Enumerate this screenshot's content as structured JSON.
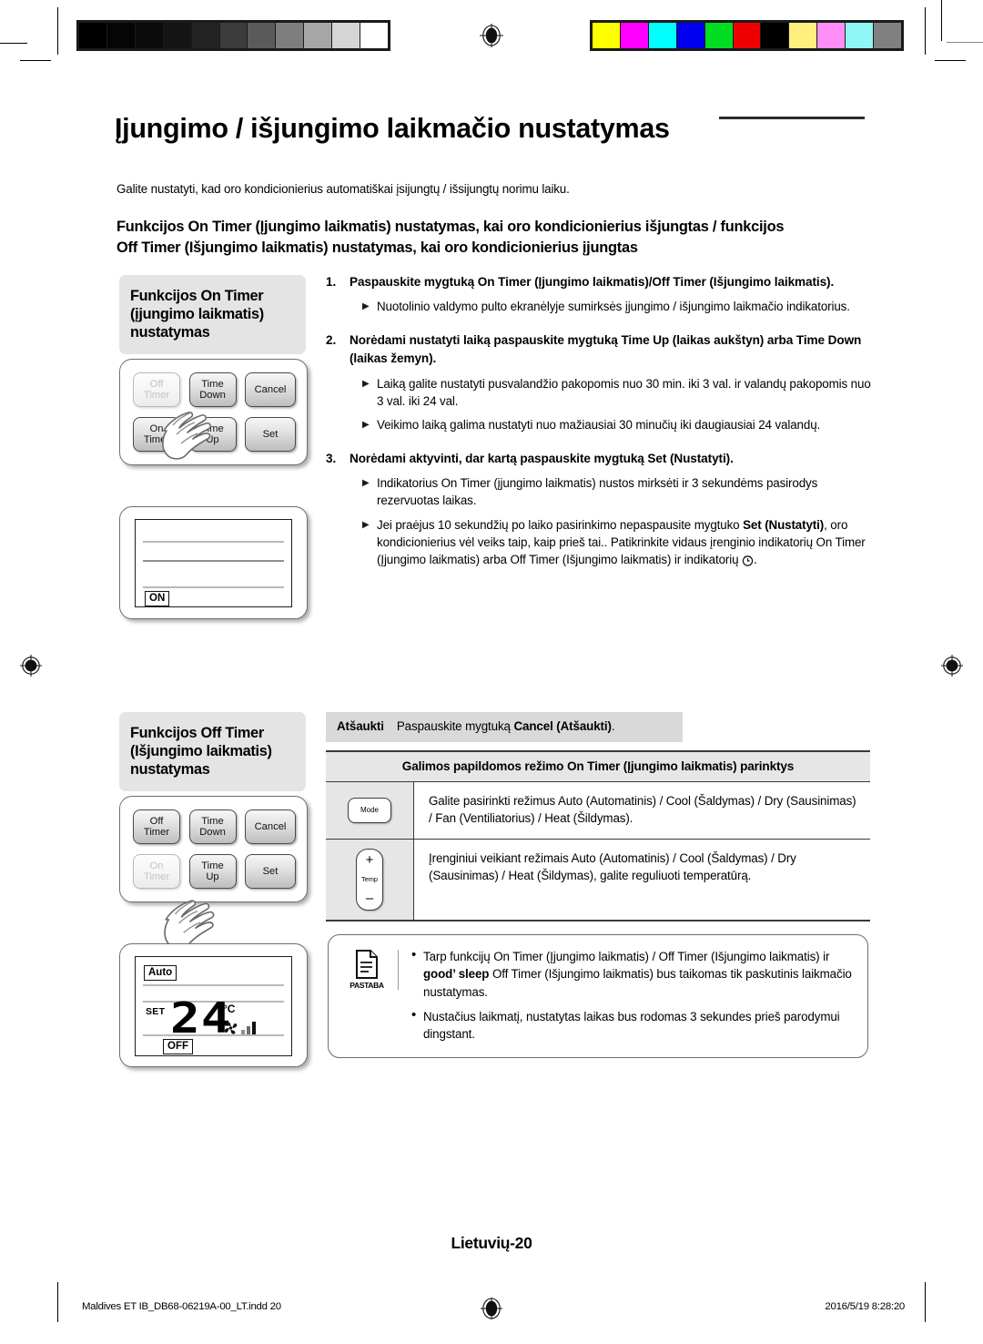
{
  "document": {
    "title": "Įjungimo / išjungimo laikmačio nustatymas",
    "intro": "Galite nustatyti, kad oro kondicionierius automatiškai įsijungtų / išsijungtų norimu laiku.",
    "subheading_line1": "Funkcijos On Timer (Įjungimo laikmatis) nustatymas, kai oro kondicionierius išjungtas / funkcijos",
    "subheading_line2": "Off Timer (Išjungimo laikmatis) nustatymas, kai oro kondicionierius įjungtas",
    "page_number": "Lietuvių-20",
    "footer_left": "Maldives ET IB_DB68-06219A-00_LT.indd   20",
    "footer_right": "2016/5/19   8:28:20"
  },
  "calibration": {
    "grayscale": [
      "#000000",
      "#050505",
      "#0b0b0b",
      "#141414",
      "#232323",
      "#3c3c3c",
      "#5a5a5a",
      "#7e7e7e",
      "#a6a6a6",
      "#d5d5d5",
      "#ffffff"
    ],
    "colors": [
      "#ffff00",
      "#ff00ff",
      "#00ffff",
      "#0000ee",
      "#00dd22",
      "#ee0000",
      "#000000",
      "#ffef7d",
      "#ff8df6",
      "#8ff6f6",
      "#808080"
    ]
  },
  "sections": [
    {
      "label": "Funkcijos On Timer (įjungimo laikmatis) nustatymas",
      "keypad": {
        "keys": [
          {
            "line1": "On",
            "line2": "Timer",
            "state": "active"
          },
          {
            "line1": "Time",
            "line2": "Up",
            "state": "normal"
          },
          {
            "line1": "Set",
            "line2": "",
            "state": "normal"
          },
          {
            "line1": "Off",
            "line2": "Timer",
            "state": "dim"
          },
          {
            "line1": "Time",
            "line2": "Down",
            "state": "normal"
          },
          {
            "line1": "Cancel",
            "line2": "",
            "state": "normal"
          }
        ]
      },
      "lcd": {
        "tag": "ON"
      }
    },
    {
      "label": "Funkcijos Off Timer (Išjungimo laikmatis) nustatymas",
      "keypad": {
        "keys": [
          {
            "line1": "On",
            "line2": "Timer",
            "state": "dim"
          },
          {
            "line1": "Time",
            "line2": "Up",
            "state": "normal"
          },
          {
            "line1": "Set",
            "line2": "",
            "state": "normal"
          },
          {
            "line1": "Off",
            "line2": "Timer",
            "state": "active"
          },
          {
            "line1": "Time",
            "line2": "Down",
            "state": "normal"
          },
          {
            "line1": "Cancel",
            "line2": "",
            "state": "normal"
          }
        ]
      },
      "lcd": {
        "mode_tag": "Auto",
        "set_label": "SET",
        "temperature": "24",
        "unit": "°C",
        "tag": "OFF"
      }
    }
  ],
  "steps": [
    {
      "number": "1.",
      "text_plain": "Paspauskite mygtuką On Timer (Įjungimo laikmatis)/Off Timer (Išjungimo laikmatis).",
      "text_html": "Paspauskite mygtuką <b>On Timer (Įjungimo laikmatis)/Off Timer (Išjungimo laikmatis)</b>.",
      "bullets": [
        {
          "text_html": "Nuotolinio valdymo pulto ekranėlyje sumirksės įjungimo / išjungimo laikmačio indikatorius."
        }
      ]
    },
    {
      "number": "2.",
      "text_plain": "Norėdami nustatyti laiką paspauskite mygtuką Time Up (laikas aukštyn) arba Time Down (laikas žemyn).",
      "text_html": "Norėdami nustatyti laiką paspauskite mygtuką <b>Time Up (laikas aukštyn)</b> arba <b>Time Down (laikas žemyn)</b>.",
      "bullets": [
        {
          "text_html": "Laiką galite nustatyti pusvalandžio pakopomis nuo 30 min. iki  3 val. ir valandų pakopomis nuo 3 val. iki 24 val."
        },
        {
          "text_html": "Veikimo laiką galima nustatyti nuo mažiausiai 30 minučių iki daugiausiai 24 valandų."
        }
      ]
    },
    {
      "number": "3.",
      "text_plain": "Norėdami aktyvinti, dar kartą paspauskite mygtuką Set (Nustatyti).",
      "text_html": "Norėdami aktyvinti, dar kartą paspauskite mygtuką <b>Set (Nustatyti)</b>.",
      "bullets": [
        {
          "text_html": "Indikatorius On Timer (įjungimo laikmatis) nustos mirksėti ir 3 sekundėms pasirodys rezervuotas laikas."
        },
        {
          "text_html": "Jei praėjus 10 sekundžių po laiko pasirinkimo nepaspausite mygtuko <b>Set (Nustatyti)</b>, oro kondicionierius vėl veiks taip, kaip prieš tai.. Patikrinkite vidaus įrenginio indikatorių On Timer (Įjungimo laikmatis) arba Off Timer (Išjungimo laikmatis) ir indikatorių <span class=\"clockglyph\"><svg width=\"13\" height=\"13\" viewBox=\"0 0 13 13\"><circle cx=\"6.5\" cy=\"7\" r=\"5.1\" fill=\"none\" stroke=\"#111\" stroke-width=\"1.2\"/><path d=\"M6.5 4.1V7H8.6\" fill=\"none\" stroke=\"#111\" stroke-width=\"1.2\"/><path d=\"M3.1 1.9l1.4 1.2M9.9 1.9L8.5 3.1\" stroke=\"#111\" stroke-width=\"1.1\"/></svg></span>."
        }
      ]
    }
  ],
  "cancel_row": {
    "lead": "Atšaukti",
    "text_plain": "Paspauskite mygtuką Cancel (Atšaukti).",
    "text_html": "Paspauskite mygtuką <b>Cancel (Atšaukti)</b>."
  },
  "options_table": {
    "header": "Galimos papildomos režimo On Timer (Įjungimo laikmatis) parinktys",
    "rows": [
      {
        "icon_label": "Mode",
        "icon_name": "mode-button-icon",
        "text": "Galite pasirinkti režimus Auto (Automatinis) / Cool (Šaldymas) / Dry (Sausinimas) / Fan (Ventiliatorius) / Heat (Šildymas)."
      },
      {
        "icon_label": "Temp",
        "icon_plus": "+",
        "icon_minus": "–",
        "icon_name": "temp-button-icon",
        "text": "Įrenginiui veikiant režimais Auto (Automatinis) / Cool (Šaldymas) / Dry (Sausinimas) / Heat (Šildymas), galite reguliuoti temperatūrą."
      }
    ]
  },
  "note_box": {
    "icon_caption": "PASTABA",
    "items": [
      {
        "text_html": "Tarp funkcijų On Timer (Įjungimo laikmatis) / Off Timer (Išjungimo laikmatis) ir <b>good’ sleep</b> Off Timer (Išjungimo laikmatis) bus taikomas tik paskutinis laikmačio nustatymas."
      },
      {
        "text_html": "Nustačius laikmatį, nustatytas laikas bus rodomas 3 sekundes prieš parodymui dingstant."
      }
    ]
  }
}
